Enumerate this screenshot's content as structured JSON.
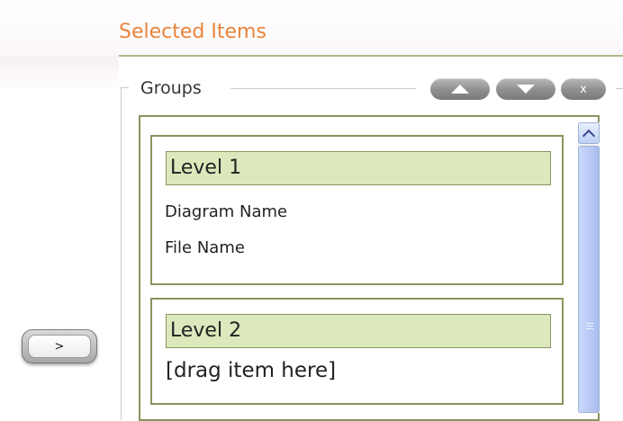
{
  "section": {
    "title": "Selected Items"
  },
  "groups": {
    "legend": "Groups",
    "controls": {
      "up_icon": "triangle-up-icon",
      "down_icon": "triangle-down-icon",
      "remove_label": "x"
    }
  },
  "levels": [
    {
      "title": "Level 1",
      "items": [
        "Diagram Name",
        "File Name"
      ]
    },
    {
      "title": "Level 2",
      "items": [
        "[drag item here]"
      ]
    }
  ],
  "move_button": {
    "label": ">"
  },
  "colors": {
    "title": "#e8843c",
    "rule": "#a9b98a",
    "border": "#8b935e",
    "level_fill": "#dbe9bc",
    "scroll_thumb": "#b6c9f5"
  }
}
